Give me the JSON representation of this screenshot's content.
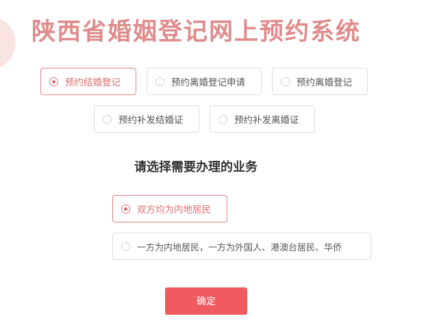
{
  "header": {
    "title": "陕西省婚姻登记网上预约系统"
  },
  "services": [
    {
      "label": "预约结婚登记",
      "selected": true
    },
    {
      "label": "预约离婚登记申请",
      "selected": false
    },
    {
      "label": "预约离婚登记",
      "selected": false
    },
    {
      "label": "预约补发结婚证",
      "selected": false
    },
    {
      "label": "预约补发离婚证",
      "selected": false
    }
  ],
  "business": {
    "heading": "请选择需要办理的业务",
    "options": [
      {
        "label": "双方均为内地居民",
        "selected": true
      },
      {
        "label": "一方为内地居民，一方为外国人、港澳台居民、华侨",
        "selected": false
      }
    ]
  },
  "actions": {
    "confirm_label": "确定"
  },
  "colors": {
    "accent": "#e08b8b",
    "button": "#f05b60"
  }
}
